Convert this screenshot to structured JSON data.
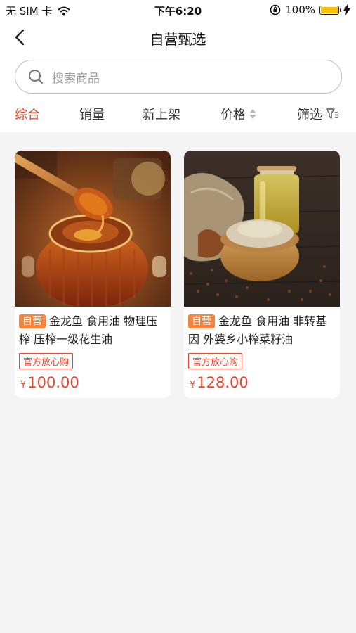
{
  "status_bar": {
    "carrier": "无 SIM 卡",
    "time": "下午6:20",
    "battery": "100%"
  },
  "nav": {
    "title": "自营甄选"
  },
  "search": {
    "placeholder": "搜索商品"
  },
  "tabs": [
    {
      "label": "综合",
      "active": true
    },
    {
      "label": "销量"
    },
    {
      "label": "新上架"
    },
    {
      "label": "价格"
    },
    {
      "label": "筛选"
    }
  ],
  "products": [
    {
      "tag": "自营",
      "title": "金龙鱼 食用油 物理压榨 压榨一级花生油",
      "badge": "官方放心购",
      "currency": "¥",
      "price": "100.00"
    },
    {
      "tag": "自营",
      "title": "金龙鱼 食用油 非转基因 外婆乡小榨菜籽油",
      "badge": "官方放心购",
      "currency": "¥",
      "price": "128.00"
    }
  ],
  "colors": {
    "accent": "#e8452c",
    "tag": "#f4833d",
    "background": "#f4f4f4"
  }
}
